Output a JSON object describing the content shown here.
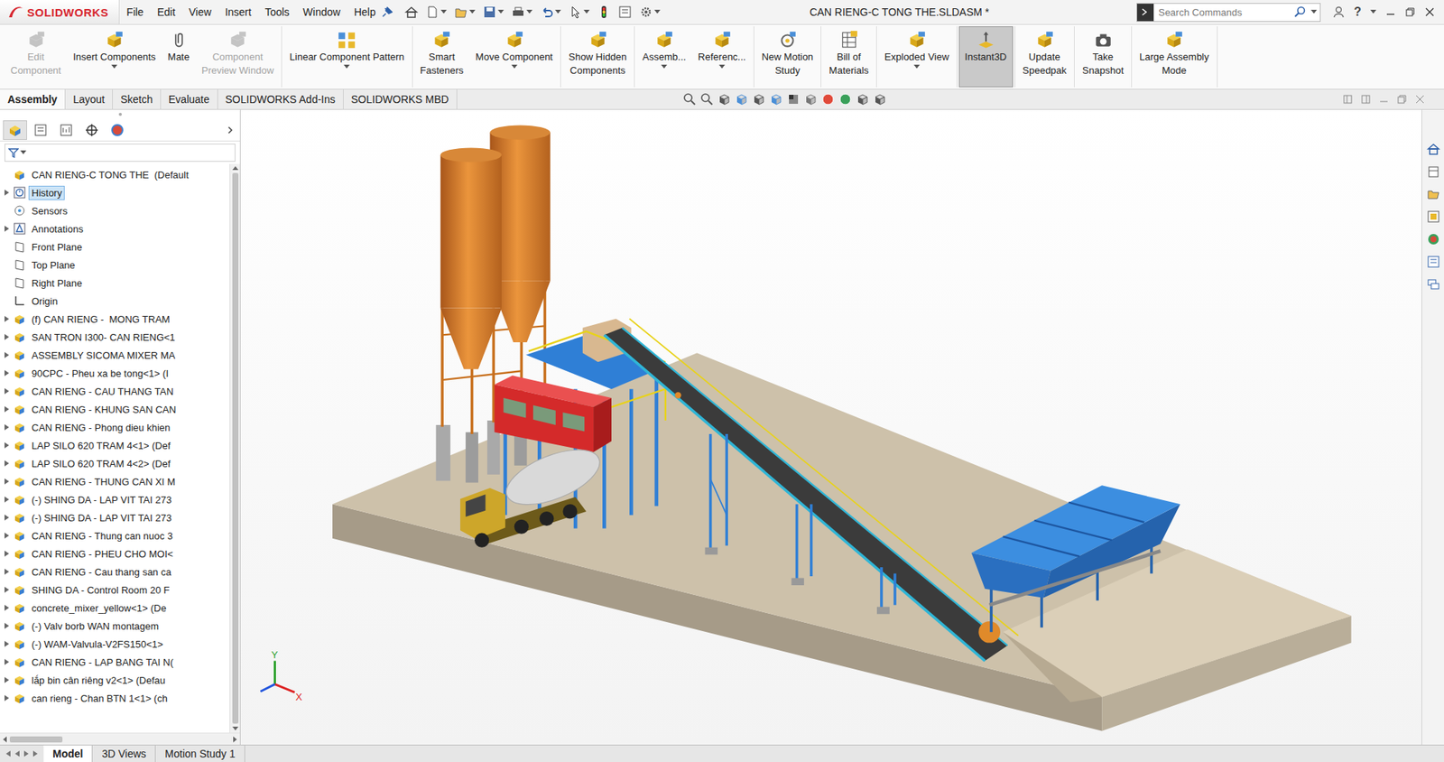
{
  "app": {
    "logo": "SOLIDWORKS",
    "menu": [
      "File",
      "Edit",
      "View",
      "Insert",
      "Tools",
      "Window",
      "Help"
    ],
    "title": "CAN RIENG-C TONG THE.SLDASM *",
    "search": {
      "placeholder": "Search Commands"
    },
    "help": "?"
  },
  "ribbon": {
    "groups": [
      {
        "buttons": [
          {
            "lines": [
              "Edit",
              "Component"
            ],
            "disabled": true,
            "selected": false,
            "dropdown": false
          },
          {
            "lines": [
              "Insert Components"
            ],
            "disabled": false,
            "selected": false,
            "dropdown": true
          },
          {
            "lines": [
              "Mate"
            ],
            "disabled": false,
            "selected": false,
            "dropdown": false
          },
          {
            "lines": [
              "Component",
              "Preview Window"
            ],
            "disabled": true,
            "selected": false,
            "dropdown": false
          }
        ]
      },
      {
        "buttons": [
          {
            "lines": [
              "Linear Component Pattern"
            ],
            "disabled": false,
            "selected": false,
            "dropdown": true
          }
        ]
      },
      {
        "buttons": [
          {
            "lines": [
              "Smart",
              "Fasteners"
            ],
            "disabled": false,
            "selected": false,
            "dropdown": false
          },
          {
            "lines": [
              "Move Component"
            ],
            "disabled": false,
            "selected": false,
            "dropdown": true
          }
        ]
      },
      {
        "buttons": [
          {
            "lines": [
              "Show Hidden",
              "Components"
            ],
            "disabled": false,
            "selected": false,
            "dropdown": false
          }
        ]
      },
      {
        "buttons": [
          {
            "lines": [
              "Assemb..."
            ],
            "disabled": false,
            "selected": false,
            "dropdown": true
          },
          {
            "lines": [
              "Referenc..."
            ],
            "disabled": false,
            "selected": false,
            "dropdown": true
          }
        ]
      },
      {
        "buttons": [
          {
            "lines": [
              "New Motion",
              "Study"
            ],
            "disabled": false,
            "selected": false,
            "dropdown": false
          }
        ]
      },
      {
        "buttons": [
          {
            "lines": [
              "Bill of",
              "Materials"
            ],
            "disabled": false,
            "selected": false,
            "dropdown": false
          }
        ]
      },
      {
        "buttons": [
          {
            "lines": [
              "Exploded View"
            ],
            "disabled": false,
            "selected": false,
            "dropdown": true
          }
        ]
      },
      {
        "buttons": [
          {
            "lines": [
              "Instant3D"
            ],
            "disabled": false,
            "selected": true,
            "dropdown": false
          }
        ]
      },
      {
        "buttons": [
          {
            "lines": [
              "Update",
              "Speedpak"
            ],
            "disabled": false,
            "selected": false,
            "dropdown": false
          }
        ]
      },
      {
        "buttons": [
          {
            "lines": [
              "Take",
              "Snapshot"
            ],
            "disabled": false,
            "selected": false,
            "dropdown": false
          }
        ]
      },
      {
        "buttons": [
          {
            "lines": [
              "Large Assembly",
              "Mode"
            ],
            "disabled": false,
            "selected": false,
            "dropdown": false
          }
        ]
      }
    ]
  },
  "tabs": [
    {
      "label": "Assembly",
      "selected": true
    },
    {
      "label": "Layout",
      "selected": false
    },
    {
      "label": "Sketch",
      "selected": false
    },
    {
      "label": "Evaluate",
      "selected": false
    },
    {
      "label": "SOLIDWORKS Add-Ins",
      "selected": false
    },
    {
      "label": "SOLIDWORKS MBD",
      "selected": false
    }
  ],
  "tree": {
    "items": [
      {
        "label": "CAN RIENG-C TONG THE  (Default",
        "kind": "root",
        "expandable": false,
        "selected": false
      },
      {
        "label": "History",
        "kind": "history",
        "expandable": true,
        "selected": true
      },
      {
        "label": "Sensors",
        "kind": "sensors",
        "expandable": false,
        "selected": false
      },
      {
        "label": "Annotations",
        "kind": "annotations",
        "expandable": true,
        "selected": false
      },
      {
        "label": "Front Plane",
        "kind": "plane",
        "expandable": false,
        "selected": false
      },
      {
        "label": "Top Plane",
        "kind": "plane",
        "expandable": false,
        "selected": false
      },
      {
        "label": "Right Plane",
        "kind": "plane",
        "expandable": false,
        "selected": false
      },
      {
        "label": "Origin",
        "kind": "origin",
        "expandable": false,
        "selected": false
      },
      {
        "label": "(f) CAN RIENG -  MONG TRAM",
        "kind": "assembly",
        "expandable": true,
        "selected": false
      },
      {
        "label": "SAN TRON I300- CAN RIENG<1",
        "kind": "assembly",
        "expandable": true,
        "selected": false
      },
      {
        "label": "ASSEMBLY SICOMA MIXER MA",
        "kind": "assembly",
        "expandable": true,
        "selected": false
      },
      {
        "label": "90CPC - Pheu xa be tong<1> (I",
        "kind": "assembly",
        "expandable": true,
        "selected": false
      },
      {
        "label": "CAN RIENG - CAU THANG TAN",
        "kind": "assembly",
        "expandable": true,
        "selected": false
      },
      {
        "label": "CAN RIENG - KHUNG SAN CAN",
        "kind": "assembly",
        "expandable": true,
        "selected": false
      },
      {
        "label": "CAN RIENG - Phong dieu khien",
        "kind": "assembly",
        "expandable": true,
        "selected": false
      },
      {
        "label": "LAP SILO 620 TRAM 4<1> (Def",
        "kind": "assembly",
        "expandable": true,
        "selected": false
      },
      {
        "label": "LAP SILO 620 TRAM 4<2> (Def",
        "kind": "assembly",
        "expandable": true,
        "selected": false
      },
      {
        "label": "CAN RIENG - THUNG CAN XI M",
        "kind": "assembly",
        "expandable": true,
        "selected": false
      },
      {
        "label": "(-) SHING DA - LAP VIT TAI 273",
        "kind": "assembly",
        "expandable": true,
        "selected": false
      },
      {
        "label": "(-) SHING DA - LAP VIT TAI 273",
        "kind": "assembly",
        "expandable": true,
        "selected": false
      },
      {
        "label": "CAN RIENG - Thung can nuoc 3",
        "kind": "assembly",
        "expandable": true,
        "selected": false
      },
      {
        "label": "CAN RIENG - PHEU CHO MOI<",
        "kind": "assembly",
        "expandable": true,
        "selected": false
      },
      {
        "label": "CAN RIENG - Cau thang san ca",
        "kind": "assembly",
        "expandable": true,
        "selected": false
      },
      {
        "label": "SHING DA - Control Room 20 F",
        "kind": "assembly",
        "expandable": true,
        "selected": false
      },
      {
        "label": "concrete_mixer_yellow<1> (De",
        "kind": "assembly",
        "expandable": true,
        "selected": false
      },
      {
        "label": "(-) Valv borb WAN montagem",
        "kind": "assembly",
        "expandable": true,
        "selected": false
      },
      {
        "label": "(-) WAM-Valvula-V2FS150<1>",
        "kind": "assembly",
        "expandable": true,
        "selected": false
      },
      {
        "label": "CAN RIENG - LAP BANG TAI N(",
        "kind": "assembly",
        "expandable": true,
        "selected": false
      },
      {
        "label": "lắp bin cân riêng v2<1> (Defau",
        "kind": "assembly",
        "expandable": true,
        "selected": false
      },
      {
        "label": "can rieng - Chan BTN 1<1> (ch",
        "kind": "assembly",
        "expandable": true,
        "selected": false
      }
    ]
  },
  "triad": {
    "x": "X",
    "y": "Y"
  },
  "bottom_tabs": [
    {
      "label": "Model",
      "selected": true
    },
    {
      "label": "3D Views",
      "selected": false
    },
    {
      "label": "Motion Study 1",
      "selected": false
    }
  ]
}
